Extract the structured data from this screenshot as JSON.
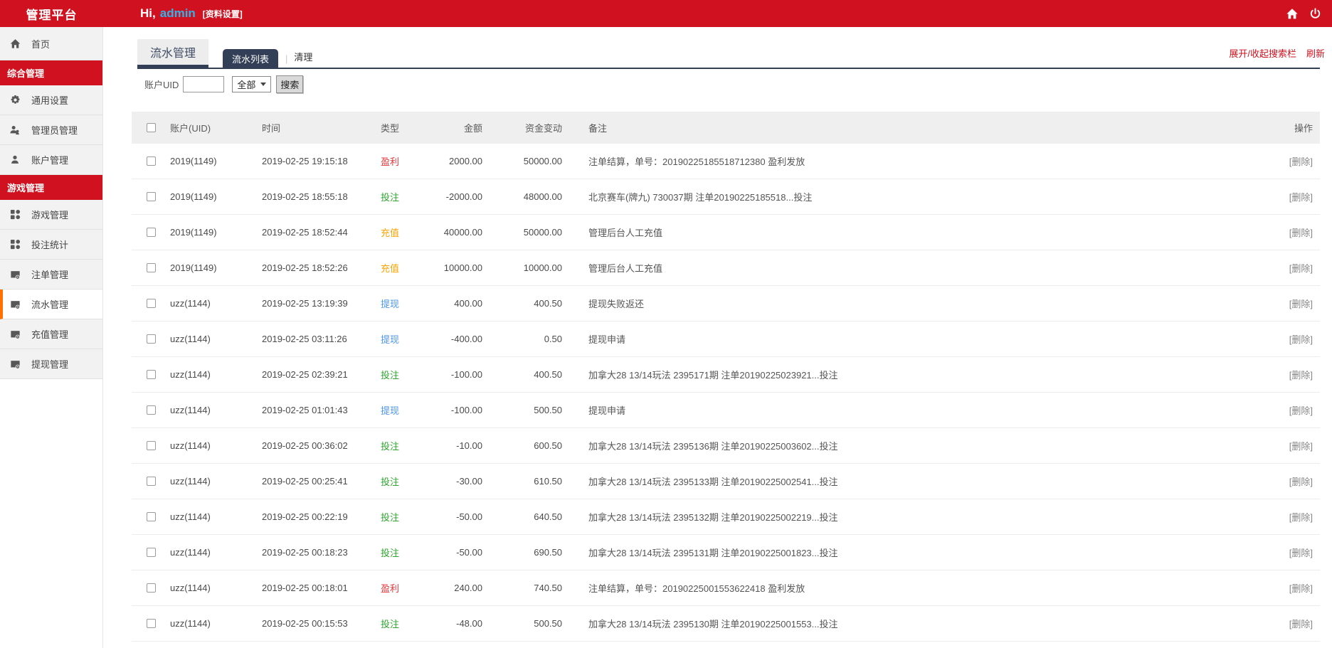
{
  "colors": {
    "brand_red": "#d0111f",
    "tab_navy": "#323f57",
    "active_orange": "#ff7000",
    "username_blue": "#2fb3ea",
    "delete_gray": "#868686"
  },
  "header": {
    "brand": "管理平台",
    "greeting": "Hi,",
    "username": "admin",
    "profile_link": "[资料设置]",
    "icons": [
      "home-icon",
      "power-icon"
    ]
  },
  "sidebar": {
    "items": [
      {
        "key": "home",
        "label": "首页",
        "icon": "home",
        "type": "item"
      },
      {
        "key": "general",
        "label": "综合管理",
        "type": "section"
      },
      {
        "key": "general-settings",
        "label": "通用设置",
        "icon": "gear",
        "type": "item"
      },
      {
        "key": "admin-management",
        "label": "管理员管理",
        "icon": "users",
        "type": "item"
      },
      {
        "key": "account-management",
        "label": "账户管理",
        "icon": "user",
        "type": "item"
      },
      {
        "key": "game",
        "label": "游戏管理",
        "type": "section"
      },
      {
        "key": "game-management",
        "label": "游戏管理",
        "icon": "grid",
        "type": "item"
      },
      {
        "key": "bet-stats",
        "label": "投注统计",
        "icon": "grid",
        "type": "item"
      },
      {
        "key": "order-management",
        "label": "注单管理",
        "icon": "doc",
        "type": "item"
      },
      {
        "key": "flow-management",
        "label": "流水管理",
        "icon": "doc",
        "type": "item",
        "active": true
      },
      {
        "key": "recharge-management",
        "label": "充值管理",
        "icon": "doc",
        "type": "item"
      },
      {
        "key": "withdraw-management",
        "label": "提现管理",
        "icon": "doc",
        "type": "item"
      }
    ]
  },
  "toolbar": {
    "toggle_search": "展开/收起搜索栏",
    "refresh": "刷新"
  },
  "tabs": {
    "main": "流水管理",
    "sub_active": "流水列表",
    "separator": "|",
    "sub_other": "清理"
  },
  "search": {
    "label": "账户UID",
    "input_value": "",
    "select_value": "全部",
    "button": "搜索"
  },
  "table": {
    "headers": {
      "account": "账户(UID)",
      "time": "时间",
      "type": "类型",
      "amount": "金额",
      "balance": "资金变动",
      "remark": "备注",
      "action": "操作"
    },
    "delete_label": "[删除]",
    "type_colors": {
      "盈利": "#e4393c",
      "投注": "#2ca52c",
      "充值": "#ffa200",
      "提现": "#4a94e8"
    },
    "rows": [
      {
        "account": "2019(1149)",
        "time": "2019-02-25 19:15:18",
        "type": "盈利",
        "amount": "2000.00",
        "balance": "50000.00",
        "remark": "注单结算，单号：20190225185518712380 盈利发放"
      },
      {
        "account": "2019(1149)",
        "time": "2019-02-25 18:55:18",
        "type": "投注",
        "amount": "-2000.00",
        "balance": "48000.00",
        "remark": "北京赛车(牌九) 730037期 注单20190225185518...投注"
      },
      {
        "account": "2019(1149)",
        "time": "2019-02-25 18:52:44",
        "type": "充值",
        "amount": "40000.00",
        "balance": "50000.00",
        "remark": "管理后台人工充值"
      },
      {
        "account": "2019(1149)",
        "time": "2019-02-25 18:52:26",
        "type": "充值",
        "amount": "10000.00",
        "balance": "10000.00",
        "remark": "管理后台人工充值"
      },
      {
        "account": "uzz(1144)",
        "time": "2019-02-25 13:19:39",
        "type": "提现",
        "amount": "400.00",
        "balance": "400.50",
        "remark": "提现失败返还"
      },
      {
        "account": "uzz(1144)",
        "time": "2019-02-25 03:11:26",
        "type": "提现",
        "amount": "-400.00",
        "balance": "0.50",
        "remark": "提现申请"
      },
      {
        "account": "uzz(1144)",
        "time": "2019-02-25 02:39:21",
        "type": "投注",
        "amount": "-100.00",
        "balance": "400.50",
        "remark": "加拿大28 13/14玩法 2395171期 注单20190225023921...投注"
      },
      {
        "account": "uzz(1144)",
        "time": "2019-02-25 01:01:43",
        "type": "提现",
        "amount": "-100.00",
        "balance": "500.50",
        "remark": "提现申请"
      },
      {
        "account": "uzz(1144)",
        "time": "2019-02-25 00:36:02",
        "type": "投注",
        "amount": "-10.00",
        "balance": "600.50",
        "remark": "加拿大28 13/14玩法 2395136期 注单20190225003602...投注"
      },
      {
        "account": "uzz(1144)",
        "time": "2019-02-25 00:25:41",
        "type": "投注",
        "amount": "-30.00",
        "balance": "610.50",
        "remark": "加拿大28 13/14玩法 2395133期 注单20190225002541...投注"
      },
      {
        "account": "uzz(1144)",
        "time": "2019-02-25 00:22:19",
        "type": "投注",
        "amount": "-50.00",
        "balance": "640.50",
        "remark": "加拿大28 13/14玩法 2395132期 注单20190225002219...投注"
      },
      {
        "account": "uzz(1144)",
        "time": "2019-02-25 00:18:23",
        "type": "投注",
        "amount": "-50.00",
        "balance": "690.50",
        "remark": "加拿大28 13/14玩法 2395131期 注单20190225001823...投注"
      },
      {
        "account": "uzz(1144)",
        "time": "2019-02-25 00:18:01",
        "type": "盈利",
        "amount": "240.00",
        "balance": "740.50",
        "remark": "注单结算，单号：20190225001553622418 盈利发放"
      },
      {
        "account": "uzz(1144)",
        "time": "2019-02-25 00:15:53",
        "type": "投注",
        "amount": "-48.00",
        "balance": "500.50",
        "remark": "加拿大28 13/14玩法 2395130期 注单20190225001553...投注"
      }
    ]
  }
}
